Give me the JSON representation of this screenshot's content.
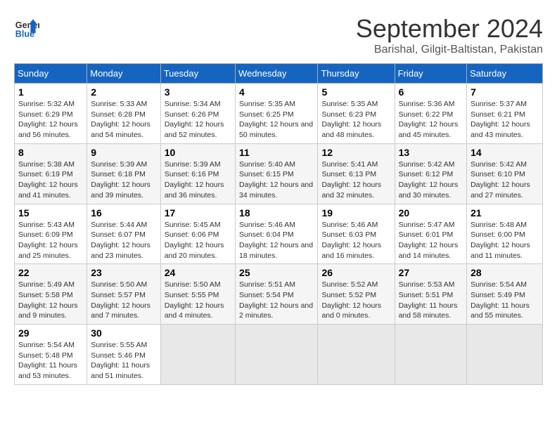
{
  "header": {
    "logo_general": "General",
    "logo_blue": "Blue",
    "month_title": "September 2024",
    "subtitle": "Barishal, Gilgit-Baltistan, Pakistan"
  },
  "days_of_week": [
    "Sunday",
    "Monday",
    "Tuesday",
    "Wednesday",
    "Thursday",
    "Friday",
    "Saturday"
  ],
  "weeks": [
    [
      {
        "day": "1",
        "sunrise": "5:32 AM",
        "sunset": "6:29 PM",
        "daylight": "12 hours and 56 minutes."
      },
      {
        "day": "2",
        "sunrise": "5:33 AM",
        "sunset": "6:28 PM",
        "daylight": "12 hours and 54 minutes."
      },
      {
        "day": "3",
        "sunrise": "5:34 AM",
        "sunset": "6:26 PM",
        "daylight": "12 hours and 52 minutes."
      },
      {
        "day": "4",
        "sunrise": "5:35 AM",
        "sunset": "6:25 PM",
        "daylight": "12 hours and 50 minutes."
      },
      {
        "day": "5",
        "sunrise": "5:35 AM",
        "sunset": "6:23 PM",
        "daylight": "12 hours and 48 minutes."
      },
      {
        "day": "6",
        "sunrise": "5:36 AM",
        "sunset": "6:22 PM",
        "daylight": "12 hours and 45 minutes."
      },
      {
        "day": "7",
        "sunrise": "5:37 AM",
        "sunset": "6:21 PM",
        "daylight": "12 hours and 43 minutes."
      }
    ],
    [
      {
        "day": "8",
        "sunrise": "5:38 AM",
        "sunset": "6:19 PM",
        "daylight": "12 hours and 41 minutes."
      },
      {
        "day": "9",
        "sunrise": "5:39 AM",
        "sunset": "6:18 PM",
        "daylight": "12 hours and 39 minutes."
      },
      {
        "day": "10",
        "sunrise": "5:39 AM",
        "sunset": "6:16 PM",
        "daylight": "12 hours and 36 minutes."
      },
      {
        "day": "11",
        "sunrise": "5:40 AM",
        "sunset": "6:15 PM",
        "daylight": "12 hours and 34 minutes."
      },
      {
        "day": "12",
        "sunrise": "5:41 AM",
        "sunset": "6:13 PM",
        "daylight": "12 hours and 32 minutes."
      },
      {
        "day": "13",
        "sunrise": "5:42 AM",
        "sunset": "6:12 PM",
        "daylight": "12 hours and 30 minutes."
      },
      {
        "day": "14",
        "sunrise": "5:42 AM",
        "sunset": "6:10 PM",
        "daylight": "12 hours and 27 minutes."
      }
    ],
    [
      {
        "day": "15",
        "sunrise": "5:43 AM",
        "sunset": "6:09 PM",
        "daylight": "12 hours and 25 minutes."
      },
      {
        "day": "16",
        "sunrise": "5:44 AM",
        "sunset": "6:07 PM",
        "daylight": "12 hours and 23 minutes."
      },
      {
        "day": "17",
        "sunrise": "5:45 AM",
        "sunset": "6:06 PM",
        "daylight": "12 hours and 20 minutes."
      },
      {
        "day": "18",
        "sunrise": "5:46 AM",
        "sunset": "6:04 PM",
        "daylight": "12 hours and 18 minutes."
      },
      {
        "day": "19",
        "sunrise": "5:46 AM",
        "sunset": "6:03 PM",
        "daylight": "12 hours and 16 minutes."
      },
      {
        "day": "20",
        "sunrise": "5:47 AM",
        "sunset": "6:01 PM",
        "daylight": "12 hours and 14 minutes."
      },
      {
        "day": "21",
        "sunrise": "5:48 AM",
        "sunset": "6:00 PM",
        "daylight": "12 hours and 11 minutes."
      }
    ],
    [
      {
        "day": "22",
        "sunrise": "5:49 AM",
        "sunset": "5:58 PM",
        "daylight": "12 hours and 9 minutes."
      },
      {
        "day": "23",
        "sunrise": "5:50 AM",
        "sunset": "5:57 PM",
        "daylight": "12 hours and 7 minutes."
      },
      {
        "day": "24",
        "sunrise": "5:50 AM",
        "sunset": "5:55 PM",
        "daylight": "12 hours and 4 minutes."
      },
      {
        "day": "25",
        "sunrise": "5:51 AM",
        "sunset": "5:54 PM",
        "daylight": "12 hours and 2 minutes."
      },
      {
        "day": "26",
        "sunrise": "5:52 AM",
        "sunset": "5:52 PM",
        "daylight": "12 hours and 0 minutes."
      },
      {
        "day": "27",
        "sunrise": "5:53 AM",
        "sunset": "5:51 PM",
        "daylight": "11 hours and 58 minutes."
      },
      {
        "day": "28",
        "sunrise": "5:54 AM",
        "sunset": "5:49 PM",
        "daylight": "11 hours and 55 minutes."
      }
    ],
    [
      {
        "day": "29",
        "sunrise": "5:54 AM",
        "sunset": "5:48 PM",
        "daylight": "11 hours and 53 minutes."
      },
      {
        "day": "30",
        "sunrise": "5:55 AM",
        "sunset": "5:46 PM",
        "daylight": "11 hours and 51 minutes."
      },
      null,
      null,
      null,
      null,
      null
    ]
  ]
}
